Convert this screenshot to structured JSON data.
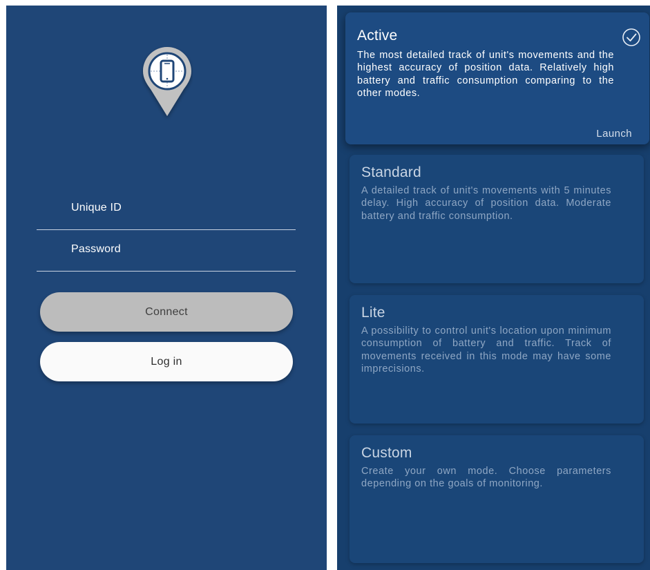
{
  "login": {
    "unique_id_label": "Unique ID",
    "password_label": "Password",
    "connect_label": "Connect",
    "login_label": "Log in"
  },
  "modes": [
    {
      "title": "Active",
      "description": "The most detailed track of unit's movements and the highest accuracy of position data. Relatively high battery and traffic consumption comparing to the other modes.",
      "launch_label": "Launch",
      "selected": true
    },
    {
      "title": "Standard",
      "description": "A detailed track of unit's movements with 5 minutes delay. High accuracy of position data. Moderate battery and traffic consumption."
    },
    {
      "title": "Lite",
      "description": "A possibility to control unit's location upon minimum consumption of battery and traffic. Track of movements received in this mode may have some imprecisions."
    },
    {
      "title": "Custom",
      "description": "Create your own mode. Choose parameters depending on the goals of monitoring."
    }
  ],
  "colors": {
    "left_background": "#1f4677",
    "right_background": "#173f6d",
    "active_card": "#1d4b82",
    "card": "#1a4678",
    "connect_button": "#bcbcbc",
    "login_button": "#fafafa"
  },
  "icons": {
    "logo": "map-pin-phone-icon",
    "selected": "check-circle-icon"
  }
}
